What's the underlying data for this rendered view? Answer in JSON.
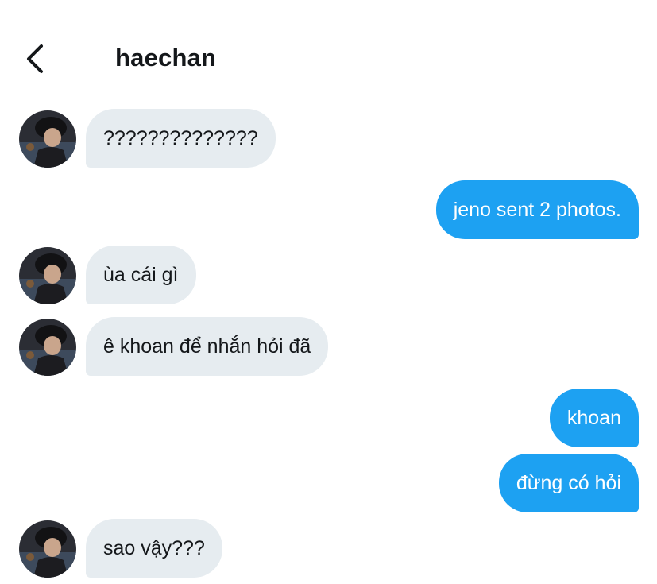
{
  "header": {
    "title": "haechan",
    "back_icon": "chevron-left-icon"
  },
  "colors": {
    "incoming_bubble": "#e6ecf0",
    "outgoing_bubble": "#1da1f2",
    "text": "#14171a"
  },
  "messages": [
    {
      "sender": "haechan",
      "direction": "in",
      "text": "??????????????"
    },
    {
      "sender": "me",
      "direction": "out",
      "text": "jeno sent 2 photos."
    },
    {
      "sender": "haechan",
      "direction": "in",
      "text": "ùa cái gì"
    },
    {
      "sender": "haechan",
      "direction": "in",
      "text": "ê khoan để nhắn hỏi đã"
    },
    {
      "sender": "me",
      "direction": "out",
      "text": "khoan"
    },
    {
      "sender": "me",
      "direction": "out",
      "text": "đừng có hỏi"
    },
    {
      "sender": "haechan",
      "direction": "in",
      "text": "sao vậy???"
    }
  ]
}
